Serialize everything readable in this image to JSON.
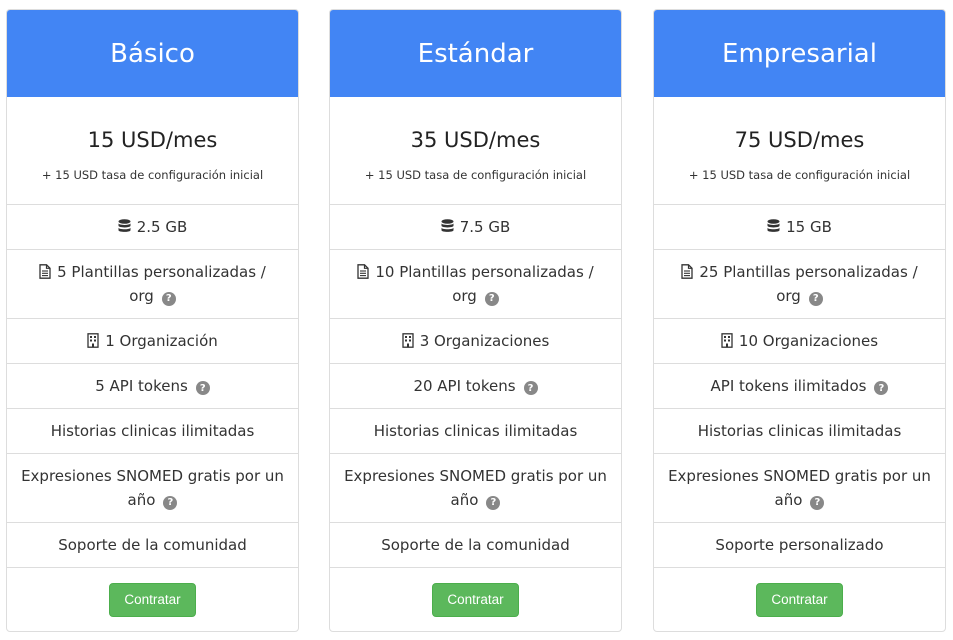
{
  "plans": [
    {
      "name": "Básico",
      "price": "15 USD/mes",
      "setup_fee": "+ 15 USD tasa de configuración inicial",
      "storage": "2.5 GB",
      "templates_line1": "5 Plantillas personalizadas /",
      "templates_line2": "org",
      "organizations": "1 Organización",
      "api_tokens": "5 API tokens",
      "records": "Historias clinicas ilimitadas",
      "snomed_line1": "Expresiones SNOMED gratis por un",
      "snomed_line2": "año",
      "support": "Soporte de la comunidad",
      "button": "Contratar"
    },
    {
      "name": "Estándar",
      "price": "35 USD/mes",
      "setup_fee": "+ 15 USD tasa de configuración inicial",
      "storage": "7.5 GB",
      "templates_line1": "10 Plantillas personalizadas /",
      "templates_line2": "org",
      "organizations": "3 Organizaciones",
      "api_tokens": "20 API tokens",
      "records": "Historias clinicas ilimitadas",
      "snomed_line1": "Expresiones SNOMED gratis por un",
      "snomed_line2": "año",
      "support": "Soporte de la comunidad",
      "button": "Contratar"
    },
    {
      "name": "Empresarial",
      "price": "75 USD/mes",
      "setup_fee": "+ 15 USD tasa de configuración inicial",
      "storage": "15 GB",
      "templates_line1": "25 Plantillas personalizadas /",
      "templates_line2": "org",
      "organizations": "10 Organizaciones",
      "api_tokens": "API tokens ilimitados",
      "records": "Historias clinicas ilimitadas",
      "snomed_line1": "Expresiones SNOMED gratis por un",
      "snomed_line2": "año",
      "support": "Soporte personalizado",
      "button": "Contratar"
    }
  ],
  "icons": {
    "storage": "database-icon",
    "templates": "file-text-icon",
    "organizations": "building-icon",
    "help": "question-circle-icon"
  },
  "help_glyph": "?",
  "colors": {
    "header": "#4285f4",
    "button": "#5cb85c",
    "border": "#dddddd",
    "help": "#888888"
  }
}
